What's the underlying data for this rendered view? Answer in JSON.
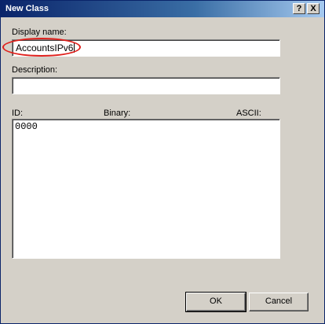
{
  "window": {
    "title": "New Class",
    "help_label": "?",
    "close_label": "X"
  },
  "form": {
    "display_name_label": "Display name:",
    "display_name_value": "AccountsIPv6",
    "description_label": "Description:",
    "description_value": "",
    "id_label": "ID:",
    "binary_label": "Binary:",
    "ascii_label": "ASCII:",
    "data_value": "0000"
  },
  "buttons": {
    "ok_label": "OK",
    "cancel_label": "Cancel"
  },
  "colors": {
    "titlebar_start": "#0a246a",
    "titlebar_end": "#a6caf0",
    "dialog_bg": "#d4d0c8",
    "highlight_ellipse": "#e0201c"
  }
}
